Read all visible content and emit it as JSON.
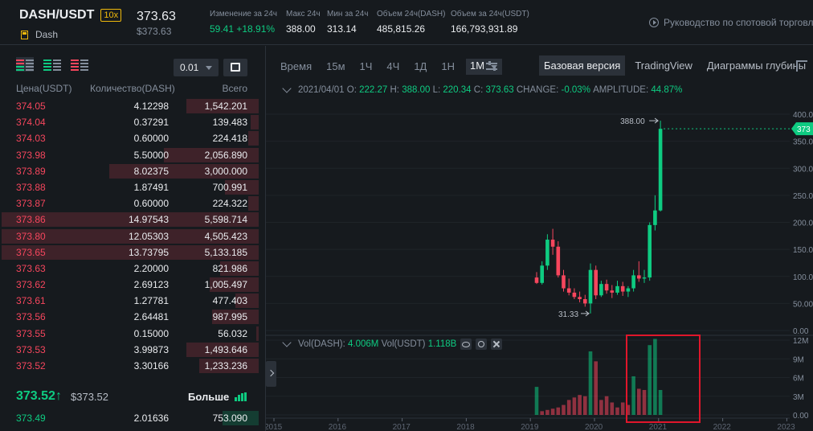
{
  "ticker": {
    "pair": "DASH/USDT",
    "leverage": "10x",
    "coin": "Dash",
    "price": "373.63",
    "price_usd": "$373.63",
    "stats": [
      {
        "label": "Изменение за 24ч",
        "value": "59.41 +18.91%",
        "green": true
      },
      {
        "label": "Макс 24ч",
        "value": "388.00",
        "green": false
      },
      {
        "label": "Мин за 24ч",
        "value": "313.14",
        "green": false
      },
      {
        "label": "Объем 24ч(DASH)",
        "value": "485,815.26",
        "green": false
      },
      {
        "label": "Объем за 24ч(USDT)",
        "value": "166,793,931.89",
        "green": false
      }
    ],
    "guide": "Руководство по спотовой торговле"
  },
  "orderbook": {
    "precision": "0.01",
    "headers": {
      "price": "Цена(USDT)",
      "qty": "Количество(DASH)",
      "total": "Всего"
    },
    "asks": [
      {
        "p": "374.05",
        "q": "4.12298",
        "t": "1,542.201",
        "d": 0.28
      },
      {
        "p": "374.04",
        "q": "0.37291",
        "t": "139.483",
        "d": 0.03
      },
      {
        "p": "374.03",
        "q": "0.60000",
        "t": "224.418",
        "d": 0.04
      },
      {
        "p": "373.98",
        "q": "5.50000",
        "t": "2,056.890",
        "d": 0.37
      },
      {
        "p": "373.89",
        "q": "8.02375",
        "t": "3,000.000",
        "d": 0.58
      },
      {
        "p": "373.88",
        "q": "1.87491",
        "t": "700.991",
        "d": 0.13
      },
      {
        "p": "373.87",
        "q": "0.60000",
        "t": "224.322",
        "d": 0.04
      },
      {
        "p": "373.86",
        "q": "14.97543",
        "t": "5,598.714",
        "d": 1.0
      },
      {
        "p": "373.80",
        "q": "12.05303",
        "t": "4,505.423",
        "d": 1.0
      },
      {
        "p": "373.65",
        "q": "13.73795",
        "t": "5,133.185",
        "d": 1.0
      },
      {
        "p": "373.63",
        "q": "2.20000",
        "t": "821.986",
        "d": 0.15
      },
      {
        "p": "373.62",
        "q": "2.69123",
        "t": "1,005.497",
        "d": 0.19
      },
      {
        "p": "373.61",
        "q": "1.27781",
        "t": "477.403",
        "d": 0.09
      },
      {
        "p": "373.56",
        "q": "2.64481",
        "t": "987.995",
        "d": 0.18
      },
      {
        "p": "373.55",
        "q": "0.15000",
        "t": "56.032",
        "d": 0.01
      },
      {
        "p": "373.53",
        "q": "3.99873",
        "t": "1,493.646",
        "d": 0.28
      },
      {
        "p": "373.52",
        "q": "3.30166",
        "t": "1,233.236",
        "d": 0.23
      }
    ],
    "last_price": "373.52",
    "last_arrow": "↑",
    "last_usd": "$373.52",
    "more_label": "Больше",
    "bid": {
      "p": "373.49",
      "q": "2.01636",
      "t": "753.090",
      "d": 0.14
    }
  },
  "chart": {
    "intervals": [
      "Время",
      "15м",
      "1Ч",
      "4Ч",
      "1Д",
      "1Н"
    ],
    "active_interval": "1М",
    "views": [
      "Базовая версия",
      "TradingView",
      "Диаграммы глубины"
    ],
    "active_view": "Базовая версия",
    "ohlc": {
      "date": "2021/04/01",
      "o_label": "O:",
      "o": "222.27",
      "h_label": "H:",
      "h": "388.00",
      "l_label": "L:",
      "l": "220.34",
      "c_label": "C:",
      "c": "373.63",
      "change_label": "CHANGE:",
      "change": "-0.03%",
      "amp_label": "AMPLITUDE:",
      "amp": "44.87%"
    },
    "vol": {
      "label1": "Vol(DASH):",
      "v1": "4.006M",
      "label2": "Vol(USDT)",
      "v2": "1.118B"
    },
    "colors": {
      "up": "#0ecb81",
      "down": "#f6465d",
      "highlight": "#e0162b"
    }
  },
  "chart_data": {
    "type": "candlestick",
    "price_axis": {
      "min": 0,
      "max": 400,
      "ticks": [
        "400.00",
        "350.00",
        "300.00",
        "250.00",
        "200.00",
        "150.00",
        "100.00",
        "50.00",
        "0.00"
      ]
    },
    "volume_axis": {
      "min": 0,
      "max": 12,
      "ticks": [
        "12M",
        "9M",
        "6M",
        "3M",
        "0.00"
      ]
    },
    "x_labels": [
      "2015",
      "2016",
      "2017",
      "2018",
      "2019",
      "2020",
      "2021",
      "2022",
      "2023"
    ],
    "current_price_tag": "373",
    "high_annotation": "388.00",
    "low_annotation": "31.33",
    "candles": [
      {
        "o": 98,
        "h": 108,
        "l": 86,
        "c": 88
      },
      {
        "o": 88,
        "h": 128,
        "l": 85,
        "c": 120
      },
      {
        "o": 120,
        "h": 178,
        "l": 112,
        "c": 168
      },
      {
        "o": 168,
        "h": 188,
        "l": 140,
        "c": 155
      },
      {
        "o": 155,
        "h": 165,
        "l": 98,
        "c": 102
      },
      {
        "o": 102,
        "h": 112,
        "l": 72,
        "c": 78
      },
      {
        "o": 78,
        "h": 96,
        "l": 65,
        "c": 70
      },
      {
        "o": 70,
        "h": 78,
        "l": 58,
        "c": 62
      },
      {
        "o": 62,
        "h": 72,
        "l": 52,
        "c": 58
      },
      {
        "o": 58,
        "h": 66,
        "l": 44,
        "c": 50
      },
      {
        "o": 50,
        "h": 124,
        "l": 31.33,
        "c": 112
      },
      {
        "o": 112,
        "h": 120,
        "l": 58,
        "c": 65
      },
      {
        "o": 65,
        "h": 92,
        "l": 62,
        "c": 86
      },
      {
        "o": 86,
        "h": 94,
        "l": 68,
        "c": 74
      },
      {
        "o": 74,
        "h": 84,
        "l": 60,
        "c": 70
      },
      {
        "o": 70,
        "h": 92,
        "l": 66,
        "c": 82
      },
      {
        "o": 82,
        "h": 90,
        "l": 64,
        "c": 72
      },
      {
        "o": 72,
        "h": 82,
        "l": 62,
        "c": 78
      },
      {
        "o": 78,
        "h": 112,
        "l": 72,
        "c": 102
      },
      {
        "o": 102,
        "h": 128,
        "l": 90,
        "c": 96
      },
      {
        "o": 96,
        "h": 112,
        "l": 88,
        "c": 98
      },
      {
        "o": 98,
        "h": 200,
        "l": 92,
        "c": 195
      },
      {
        "o": 195,
        "h": 250,
        "l": 185,
        "c": 222
      },
      {
        "o": 222,
        "h": 388,
        "l": 220,
        "c": 373
      }
    ],
    "volume": [
      4.5,
      0.6,
      0.8,
      1.0,
      1.2,
      1.6,
      2.4,
      2.8,
      3.2,
      3.0,
      10.2,
      8.6,
      2.4,
      3.0,
      2.0,
      1.2,
      2.0,
      1.6,
      6.2,
      4.2,
      4.0,
      11.2,
      12.2,
      4.0
    ],
    "volume_up": [
      true,
      false,
      false,
      false,
      false,
      false,
      false,
      false,
      false,
      false,
      true,
      false,
      false,
      false,
      false,
      false,
      false,
      false,
      true,
      false,
      false,
      true,
      true,
      true
    ]
  }
}
